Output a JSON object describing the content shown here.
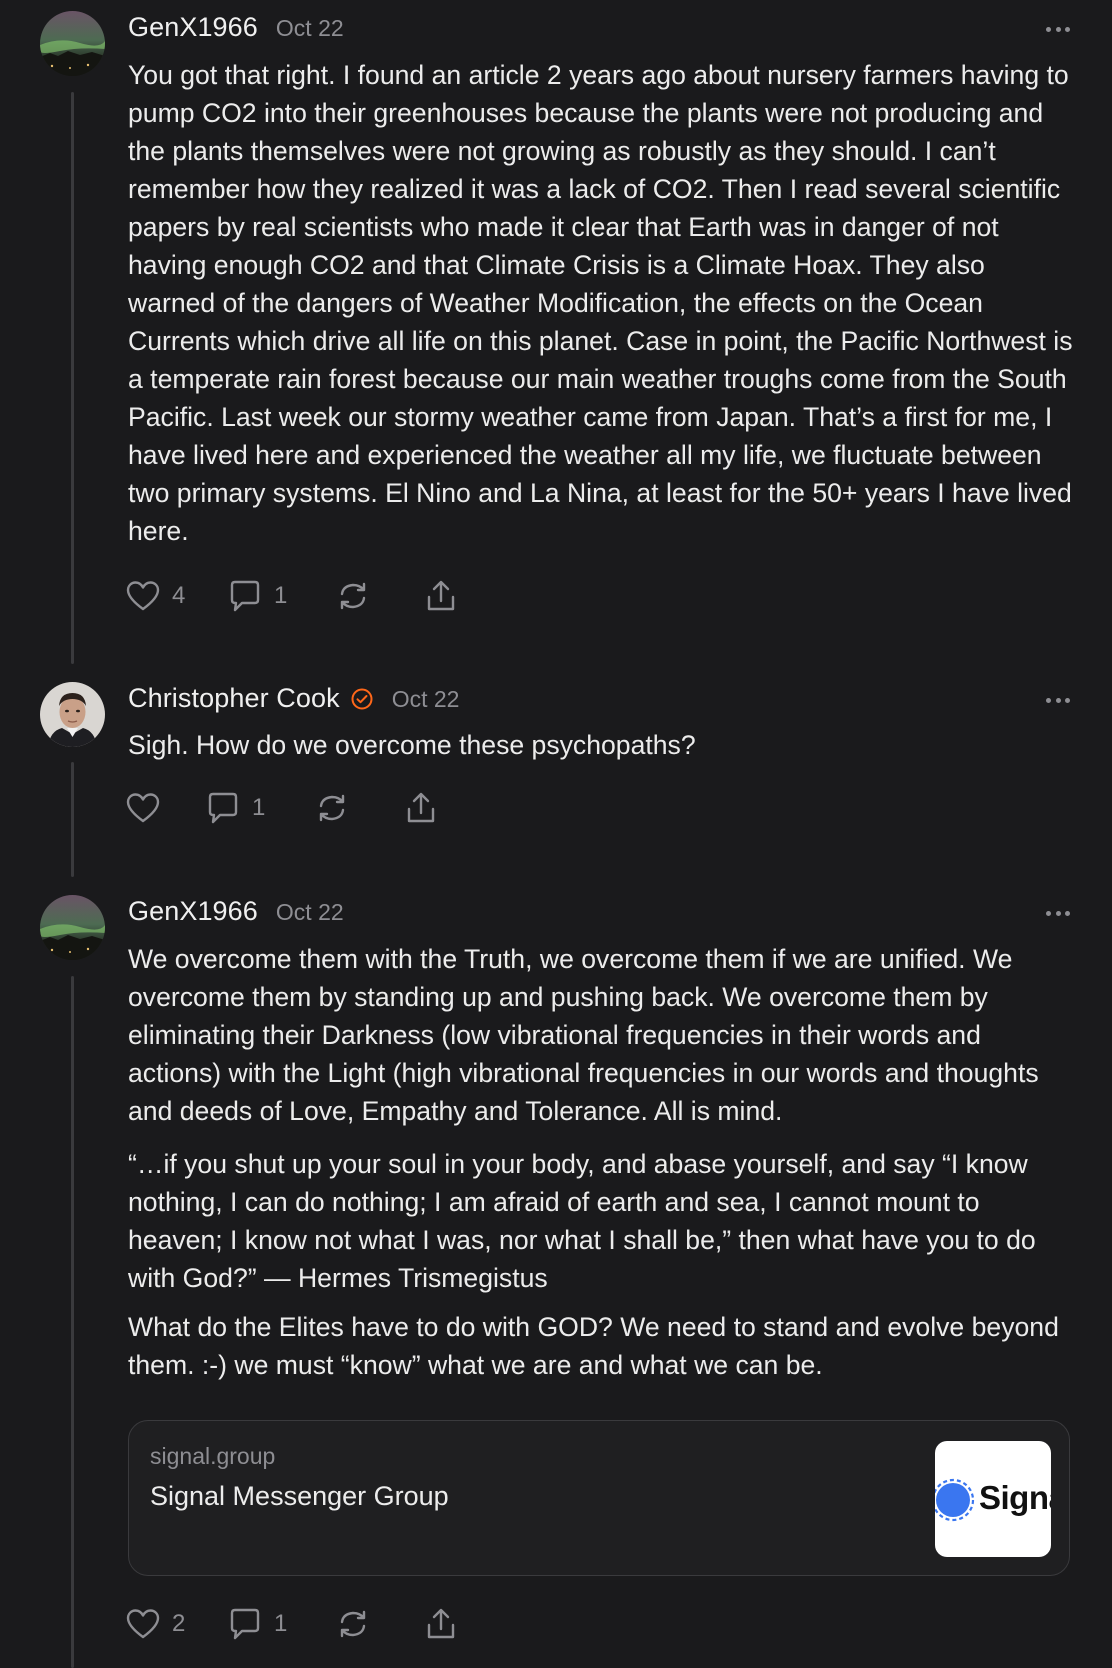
{
  "posts": [
    {
      "author": "GenX1966",
      "date": "Oct 22",
      "paragraphs": [
        "You got that right. I found an article 2 years ago about nursery farmers having to pump CO2 into their greenhouses because the plants were not producing and the plants themselves were not growing as robustly as they should. I can’t remember how they realized it was a lack of CO2. Then I read several scientific papers by real scientists who made it clear that Earth was in danger of not having enough CO2 and that Climate Crisis is a Climate Hoax. They also warned of the dangers of Weather Modification, the effects on the Ocean Currents which drive all life on this planet. Case in point, the Pacific Northwest is a temperate rain forest because our main weather troughs come from the South Pacific. Last week our stormy weather came from Japan. That’s a first for me, I have lived here and experienced the weather all my life, we fluctuate between two primary systems. El Nino and La Nina, at least for the 50+ years I have lived here."
      ],
      "likes": "4",
      "comments": "1",
      "avatar_icon": "aurora-avatar"
    },
    {
      "author": "Christopher Cook",
      "verified": true,
      "date": "Oct 22",
      "paragraphs": [
        "Sigh. How do we overcome these psychopaths?"
      ],
      "likes": "",
      "comments": "1",
      "avatar_icon": "portrait-avatar"
    },
    {
      "author": "GenX1966",
      "date": "Oct 22",
      "paragraphs": [
        "We overcome them with the Truth, we overcome them if we are unified. We overcome them by standing up and pushing back. We overcome them by eliminating their Darkness (low vibrational frequencies in their words and actions) with the Light (high vibrational frequencies in our words and thoughts and deeds of Love, Empathy and Tolerance. All is mind.",
        "“…if you shut up your soul in your body, and abase yourself, and say “I know nothing, I can do nothing; I am afraid of earth and sea, I cannot mount to heaven; I know not what I was, nor what I shall be,” then what have you to do with God?” — Hermes Trismegistus",
        "What do the Elites have to do with GOD? We need to stand and evolve beyond them. :-) we must “know” what we are and what we can be."
      ],
      "link": {
        "domain": "signal.group",
        "title": "Signal Messenger Group",
        "thumb_text": "Signa"
      },
      "likes": "2",
      "comments": "1",
      "avatar_icon": "aurora-avatar"
    }
  ],
  "colors": {
    "background": "#1a1a1c",
    "text": "#ececec",
    "muted": "#8e8e93",
    "verified": "#ff6719",
    "thread_line": "#3a3a3d"
  },
  "icons": [
    "heart-icon",
    "comment-icon",
    "restack-icon",
    "share-icon",
    "more-icon",
    "verified-icon"
  ]
}
